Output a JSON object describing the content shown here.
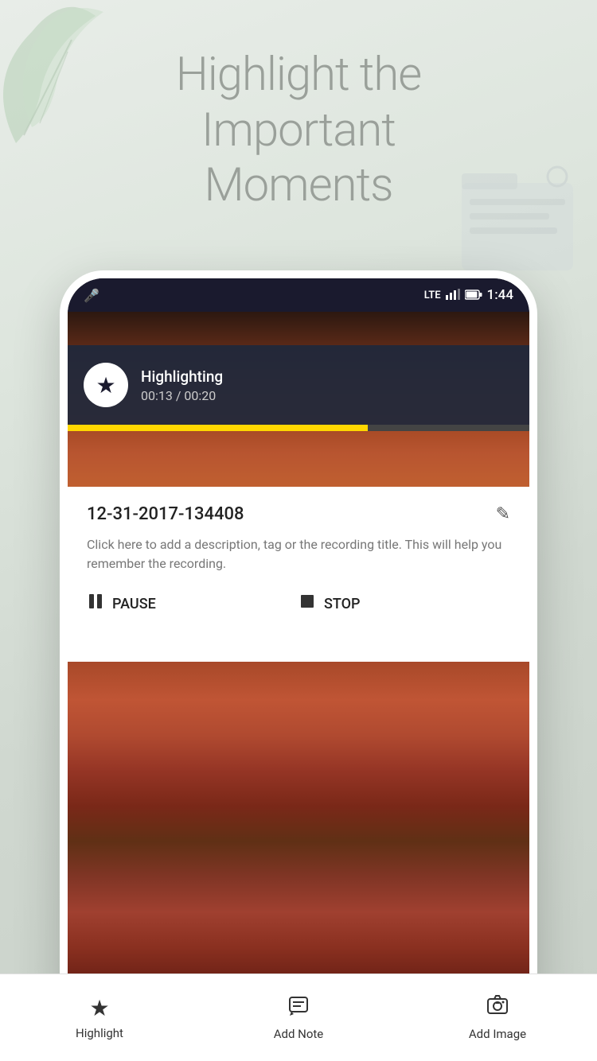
{
  "hero": {
    "line1": "Highlight the",
    "line2": "Important",
    "line3": "Moments"
  },
  "statusBar": {
    "time": "1:44",
    "mic_icon": "🎤",
    "lte_label": "LTE",
    "battery_icon": "🔋"
  },
  "notification": {
    "title": "Highlighting",
    "time_progress": "00:13 / 00:20",
    "progress_percent": 65
  },
  "recording": {
    "filename": "12-31-2017-134408",
    "description": "Click here to add a description, tag or the recording title. This will help you remember the recording.",
    "pause_label": "PAUSE",
    "stop_label": "STOP"
  },
  "tabs": [
    {
      "id": "highlight",
      "label": "Highlight",
      "icon": "★"
    },
    {
      "id": "add-note",
      "label": "Add Note",
      "icon": "💬"
    },
    {
      "id": "add-image",
      "label": "Add Image",
      "icon": "📷"
    }
  ]
}
